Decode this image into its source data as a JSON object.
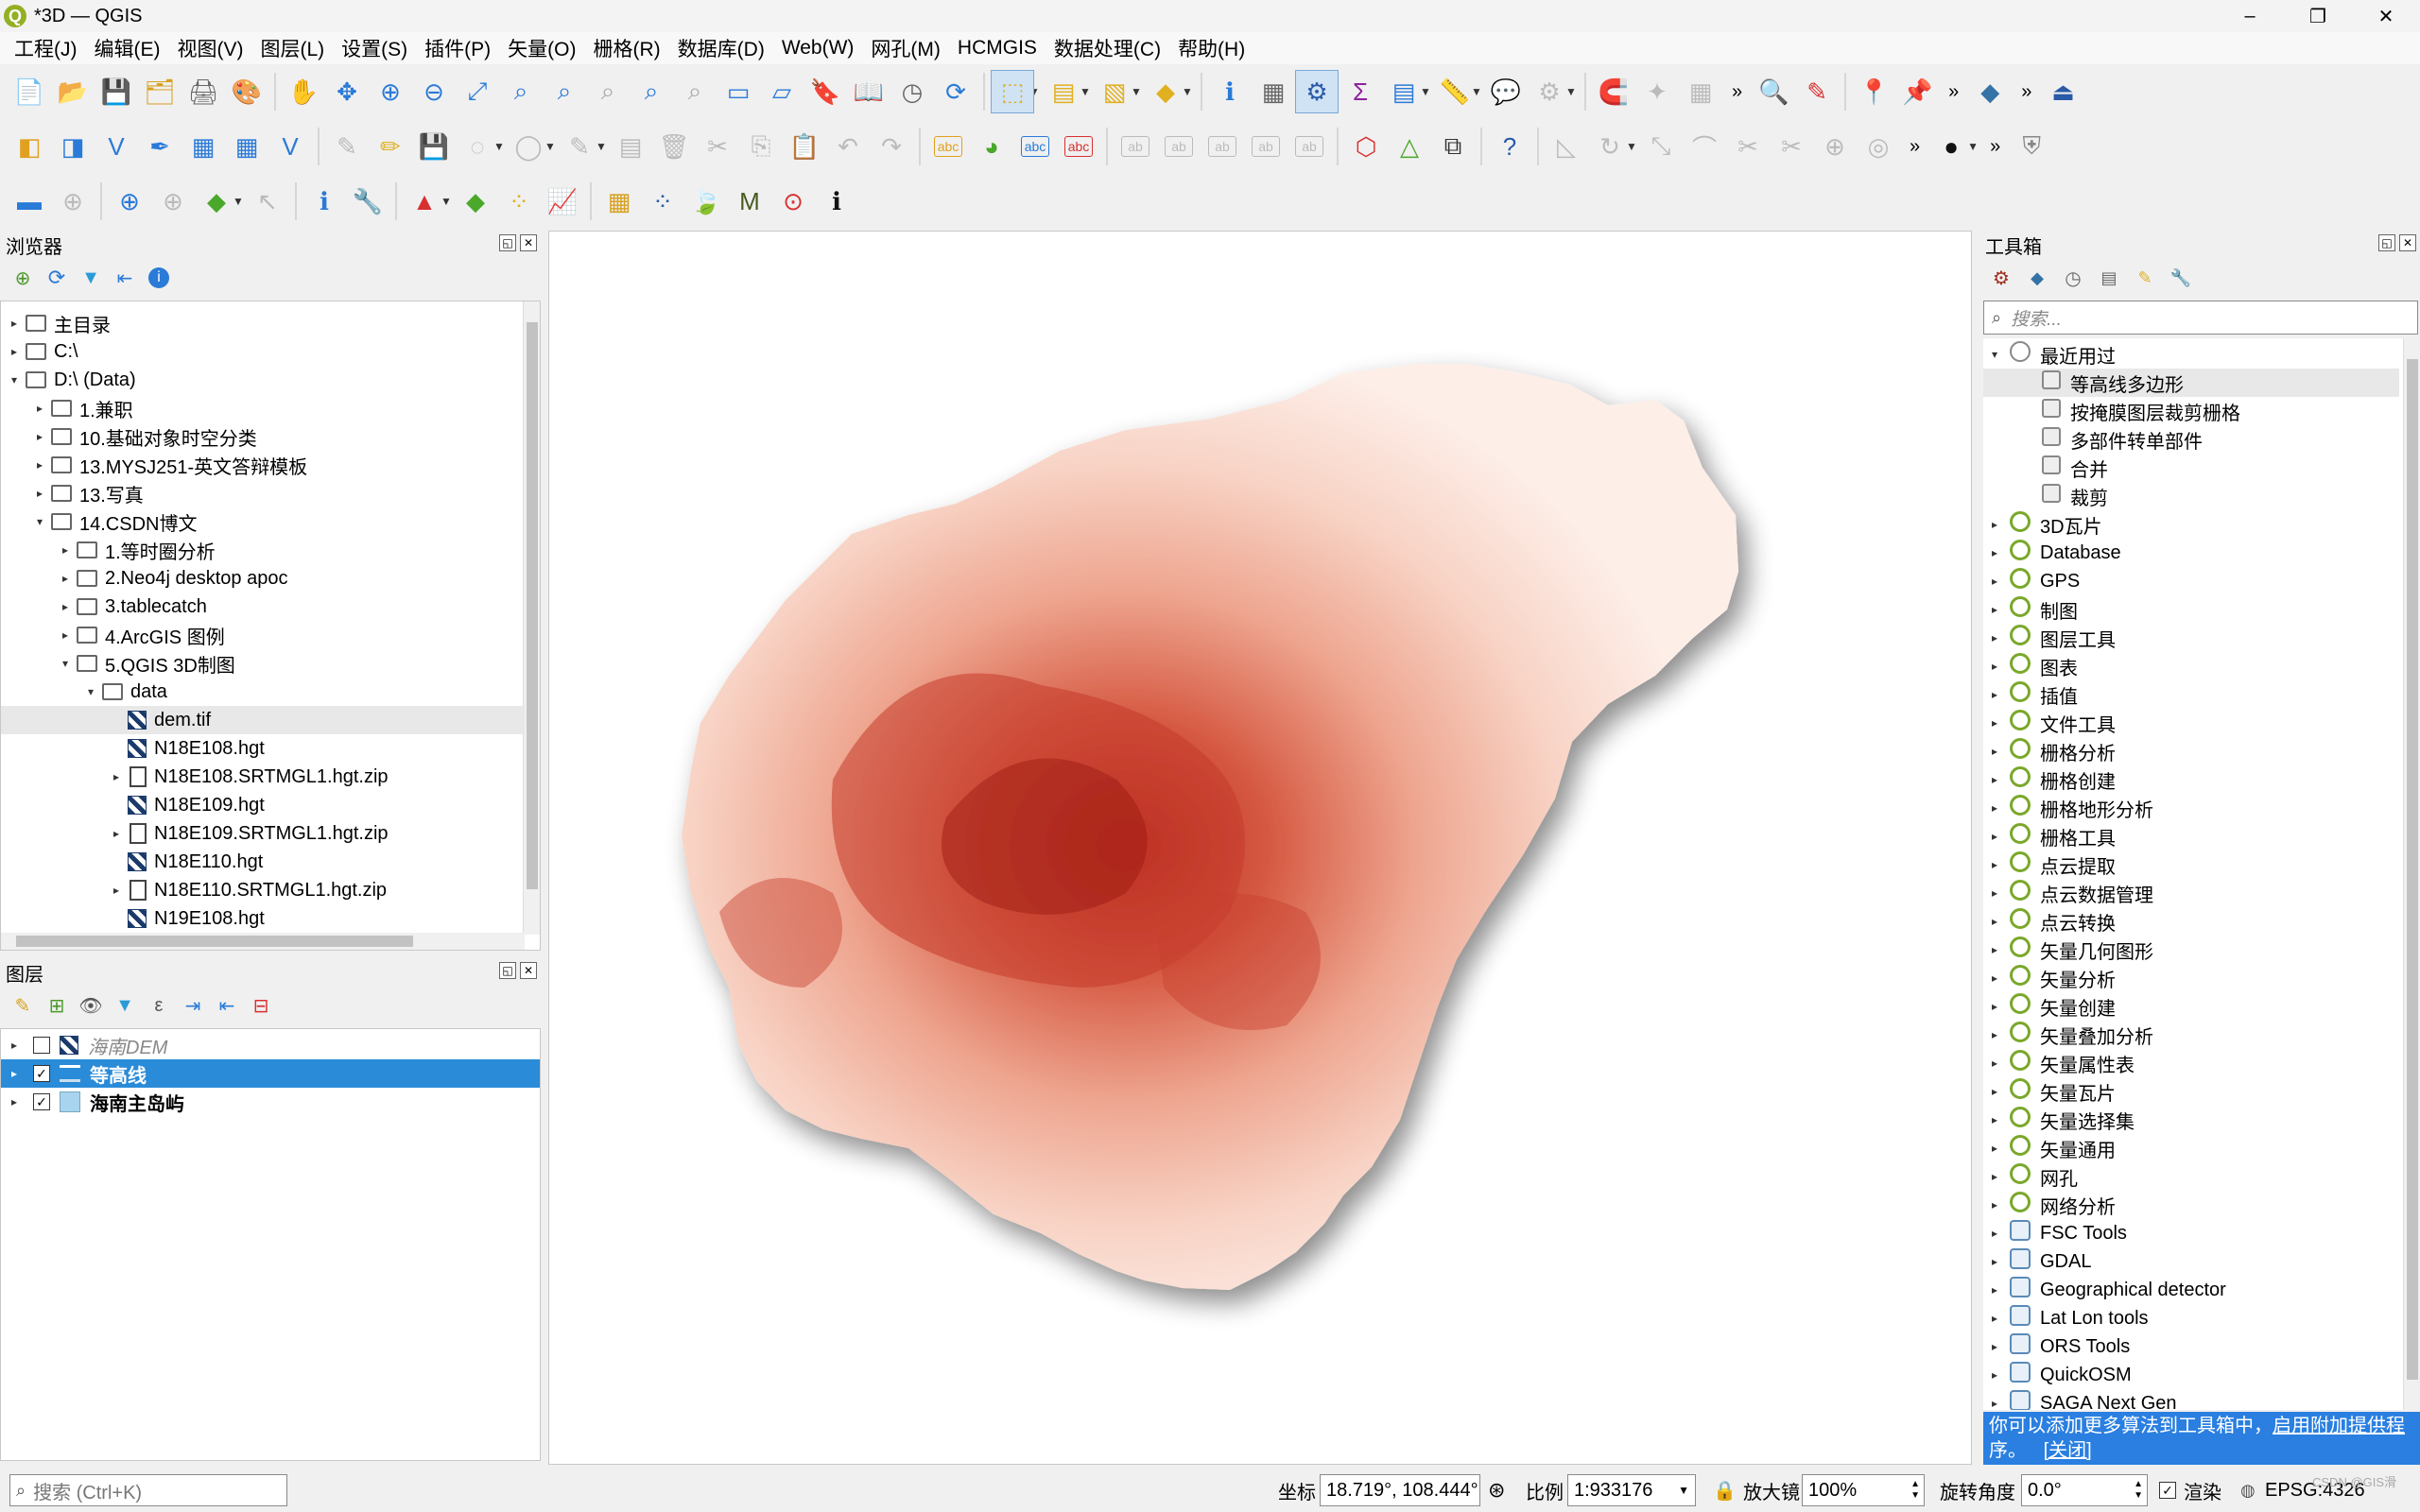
{
  "window": {
    "title": "*3D — QGIS",
    "minimize": "–",
    "maximize": "❐",
    "close": "✕"
  },
  "menu": [
    "工程(J)",
    "编辑(E)",
    "视图(V)",
    "图层(L)",
    "设置(S)",
    "插件(P)",
    "矢量(O)",
    "栅格(R)",
    "数据库(D)",
    "Web(W)",
    "网孔(M)",
    "HCMGIS",
    "数据处理(C)",
    "帮助(H)"
  ],
  "browser": {
    "title": "浏览器",
    "items": [
      {
        "label": "主目录",
        "depth": 0,
        "arrow": "▸",
        "icon": "home"
      },
      {
        "label": "C:\\",
        "depth": 0,
        "arrow": "▸",
        "icon": "folder"
      },
      {
        "label": "D:\\ (Data)",
        "depth": 0,
        "arrow": "▾",
        "icon": "folder"
      },
      {
        "label": "1.兼职",
        "depth": 1,
        "arrow": "▸",
        "icon": "folder"
      },
      {
        "label": "10.基础对象时空分类",
        "depth": 1,
        "arrow": "▸",
        "icon": "folder"
      },
      {
        "label": "13.MYSJ251-英文答辩模板",
        "depth": 1,
        "arrow": "▸",
        "icon": "folder"
      },
      {
        "label": "13.写真",
        "depth": 1,
        "arrow": "▸",
        "icon": "folder"
      },
      {
        "label": "14.CSDN博文",
        "depth": 1,
        "arrow": "▾",
        "icon": "folder"
      },
      {
        "label": "1.等时圈分析",
        "depth": 2,
        "arrow": "▸",
        "icon": "folder"
      },
      {
        "label": "2.Neo4j desktop apoc",
        "depth": 2,
        "arrow": "▸",
        "icon": "folder"
      },
      {
        "label": "3.tablecatch",
        "depth": 2,
        "arrow": "▸",
        "icon": "folder"
      },
      {
        "label": "4.ArcGIS 图例",
        "depth": 2,
        "arrow": "▸",
        "icon": "folder"
      },
      {
        "label": "5.QGIS 3D制图",
        "depth": 2,
        "arrow": "▾",
        "icon": "folder"
      },
      {
        "label": "data",
        "depth": 3,
        "arrow": "▾",
        "icon": "folder"
      },
      {
        "label": "dem.tif",
        "depth": 4,
        "arrow": "",
        "icon": "raster",
        "selected": true
      },
      {
        "label": "N18E108.hgt",
        "depth": 4,
        "arrow": "",
        "icon": "raster"
      },
      {
        "label": "N18E108.SRTMGL1.hgt.zip",
        "depth": 4,
        "arrow": "▸",
        "icon": "zip"
      },
      {
        "label": "N18E109.hgt",
        "depth": 4,
        "arrow": "",
        "icon": "raster"
      },
      {
        "label": "N18E109.SRTMGL1.hgt.zip",
        "depth": 4,
        "arrow": "▸",
        "icon": "zip"
      },
      {
        "label": "N18E110.hgt",
        "depth": 4,
        "arrow": "",
        "icon": "raster"
      },
      {
        "label": "N18E110.SRTMGL1.hgt.zip",
        "depth": 4,
        "arrow": "▸",
        "icon": "zip"
      },
      {
        "label": "N19E108.hgt",
        "depth": 4,
        "arrow": "",
        "icon": "raster"
      }
    ]
  },
  "layers": {
    "title": "图层",
    "items": [
      {
        "label": "海南DEM",
        "checked": false,
        "italic": true,
        "icon": "raster",
        "selected": false
      },
      {
        "label": "等高线",
        "checked": true,
        "italic": false,
        "icon": "line",
        "selected": true
      },
      {
        "label": "海南主岛屿",
        "checked": true,
        "italic": false,
        "icon": "polygon",
        "selected": false
      }
    ]
  },
  "toolbox": {
    "title": "工具箱",
    "search_placeholder": "搜索...",
    "recent_label": "最近用过",
    "recent": [
      "等高线多边形",
      "按掩膜图层裁剪栅格",
      "多部件转单部件",
      "合并",
      "裁剪"
    ],
    "groups": [
      "3D瓦片",
      "Database",
      "GPS",
      "制图",
      "图层工具",
      "图表",
      "插值",
      "文件工具",
      "栅格分析",
      "栅格创建",
      "栅格地形分析",
      "栅格工具",
      "点云提取",
      "点云数据管理",
      "点云转换",
      "矢量几何图形",
      "矢量分析",
      "矢量创建",
      "矢量叠加分析",
      "矢量属性表",
      "矢量瓦片",
      "矢量选择集",
      "矢量通用",
      "网孔",
      "网络分析"
    ],
    "providers": [
      "FSC Tools",
      "GDAL",
      "Geographical detector",
      "Lat Lon tools",
      "ORS Tools",
      "QuickOSM",
      "SAGA Next Gen"
    ],
    "info_line1": "你可以添加更多算法到工具箱中，",
    "info_link1": "启用附加提供程",
    "info_line2": "序。",
    "info_link2": "[关闭]"
  },
  "statusbar": {
    "search_placeholder": "搜索 (Ctrl+K)",
    "coord_label": "坐标",
    "coord_value": "18.719°, 108.444°",
    "scale_label": "比例",
    "scale_value": "1:933176",
    "magnifier_label": "放大镜",
    "magnifier_value": "100%",
    "rotation_label": "旋转角度",
    "rotation_value": "0.0°",
    "render_label": "渲染",
    "crs": "EPSG:4326",
    "watermark": "CSDN @GIS滑"
  },
  "colors": {
    "selection": "#2a8bd8",
    "map_low": "#fdeee8",
    "map_mid": "#f3b7a2",
    "map_high": "#b5261e",
    "info_bg": "#2a7fe0"
  }
}
